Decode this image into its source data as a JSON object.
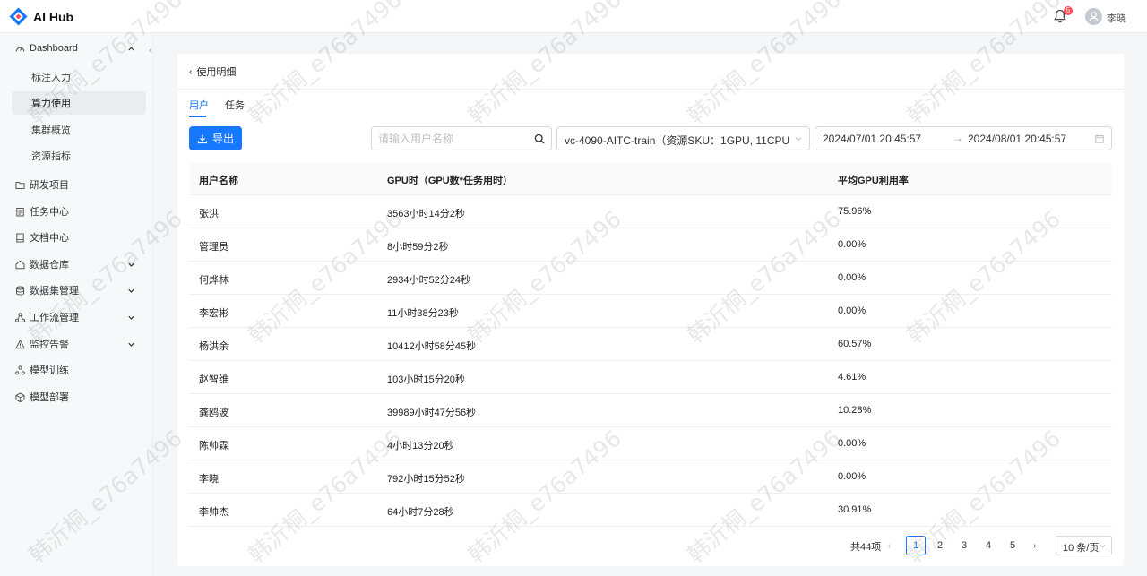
{
  "app": {
    "name": "AI Hub",
    "notification_count": "5",
    "username": "李晓"
  },
  "sidebar": {
    "dashboard": {
      "label": "Dashboard",
      "children": [
        "标注人力",
        "算力使用",
        "集群概览",
        "资源指标"
      ],
      "active_child": 1
    },
    "items": [
      {
        "label": "研发项目",
        "icon": "folder-icon",
        "expandable": false
      },
      {
        "label": "任务中心",
        "icon": "task-icon",
        "expandable": false
      },
      {
        "label": "文档中心",
        "icon": "document-icon",
        "expandable": false
      },
      {
        "label": "数据仓库",
        "icon": "warehouse-icon",
        "expandable": true
      },
      {
        "label": "数据集管理",
        "icon": "database-icon",
        "expandable": true
      },
      {
        "label": "工作流管理",
        "icon": "workflow-icon",
        "expandable": true
      },
      {
        "label": "监控告警",
        "icon": "alert-icon",
        "expandable": true
      },
      {
        "label": "模型训练",
        "icon": "model-training-icon",
        "expandable": false
      },
      {
        "label": "模型部署",
        "icon": "model-deploy-icon",
        "expandable": false
      }
    ]
  },
  "page": {
    "back_label": "使用明细",
    "tabs": [
      "用户",
      "任务"
    ],
    "active_tab": 0
  },
  "toolbar": {
    "export_label": "导出",
    "search_placeholder": "请输入用户名称",
    "resource_select": "vc-4090-AITC-train（资源SKU：1GPU, 11CPU, 1...",
    "date_start": "2024/07/01 20:45:57",
    "date_separator": "→",
    "date_end": "2024/08/01 20:45:57"
  },
  "table": {
    "columns": [
      "用户名称",
      "GPU时（GPU数*任务用时）",
      "平均GPU利用率"
    ],
    "rows": [
      [
        "张洪",
        "3563小时14分2秒",
        "75.96%"
      ],
      [
        "管理员",
        "8小时59分2秒",
        "0.00%"
      ],
      [
        "何烨林",
        "2934小时52分24秒",
        "0.00%"
      ],
      [
        "李宏彬",
        "11小时38分23秒",
        "0.00%"
      ],
      [
        "杨洪余",
        "10412小时58分45秒",
        "60.57%"
      ],
      [
        "赵智维",
        "103小时15分20秒",
        "4.61%"
      ],
      [
        "龚鸥波",
        "39989小时47分56秒",
        "10.28%"
      ],
      [
        "陈帅霖",
        "4小时13分20秒",
        "0.00%"
      ],
      [
        "李晓",
        "792小时15分52秒",
        "0.00%"
      ],
      [
        "李帅杰",
        "64小时7分28秒",
        "30.91%"
      ]
    ]
  },
  "pagination": {
    "total_label": "共44项",
    "pages": [
      "1",
      "2",
      "3",
      "4",
      "5"
    ],
    "current": "1",
    "page_size_label": "10 条/页"
  },
  "watermark": {
    "text": "韩沂桐_e76a7496"
  },
  "colors": {
    "primary": "#1677ff",
    "badge": "#ff4d4f"
  }
}
